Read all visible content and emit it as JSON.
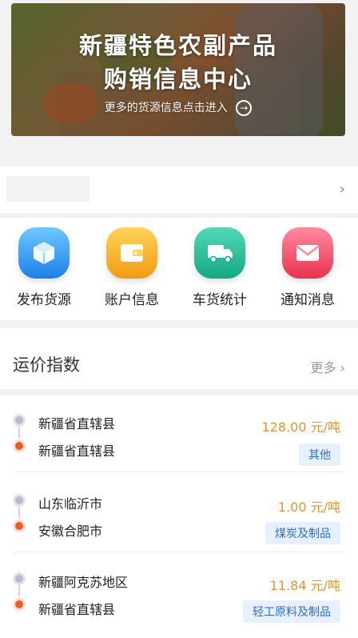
{
  "banner": {
    "title_line1": "新疆特色农副产品",
    "title_line2": "购销信息中心",
    "subtitle": "更多的货源信息点击进入",
    "arrow_icon": "arrow-right-circle-icon"
  },
  "menu": [
    {
      "label": "发布货源",
      "icon": "cube-icon",
      "color": "#1c7fe8"
    },
    {
      "label": "账户信息",
      "icon": "wallet-icon",
      "color": "#f39b10"
    },
    {
      "label": "车货统计",
      "icon": "truck-icon",
      "color": "#14a885"
    },
    {
      "label": "通知消息",
      "icon": "mail-icon",
      "color": "#e8334f"
    }
  ],
  "freight_section": {
    "title": "运价指数",
    "more_label": "更多",
    "more_icon": "chevron-right-icon"
  },
  "freight_list": [
    {
      "from": "新疆省直辖县",
      "to": "新疆省直辖县",
      "price": "128.00 元/吨",
      "category": "其他"
    },
    {
      "from": "山东临沂市",
      "to": "安徽合肥市",
      "price": "1.00 元/吨",
      "category": "煤炭及制品"
    },
    {
      "from": "新疆阿克苏地区",
      "to": "新疆省直辖县",
      "price": "11.84 元/吨",
      "category": "轻工原料及制品"
    }
  ]
}
